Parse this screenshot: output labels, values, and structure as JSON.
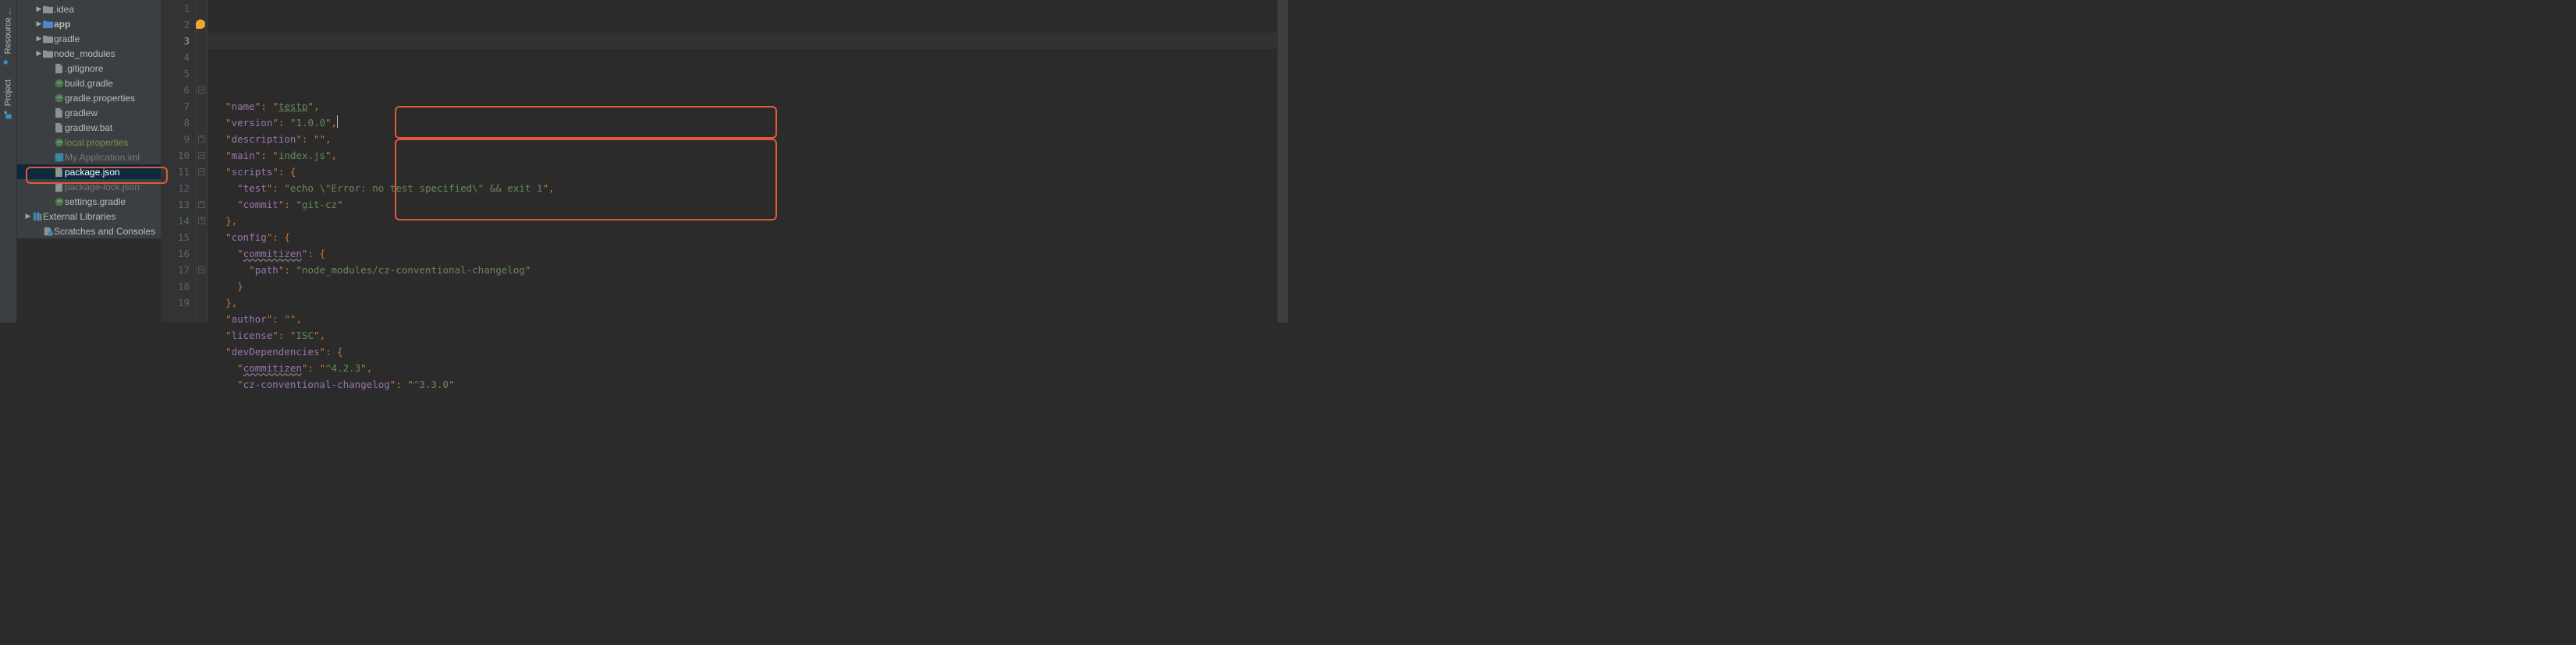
{
  "toolwindows": {
    "resource": {
      "label": "Resource ..."
    },
    "project": {
      "label": "Project"
    }
  },
  "tree": {
    "items": [
      {
        "indent": 24,
        "arrow": "▶",
        "icon": "folder",
        "label": ".idea",
        "style": ""
      },
      {
        "indent": 24,
        "arrow": "▶",
        "icon": "folder-app",
        "label": "app",
        "style": "bold"
      },
      {
        "indent": 24,
        "arrow": "▶",
        "icon": "folder",
        "label": "gradle",
        "style": ""
      },
      {
        "indent": 24,
        "arrow": "▶",
        "icon": "folder",
        "label": "node_modules",
        "style": ""
      },
      {
        "indent": 38,
        "arrow": "",
        "icon": "file",
        "label": ".gitignore",
        "style": ""
      },
      {
        "indent": 38,
        "arrow": "",
        "icon": "gradle",
        "label": "build.gradle",
        "style": ""
      },
      {
        "indent": 38,
        "arrow": "",
        "icon": "gradle",
        "label": "gradle.properties",
        "style": ""
      },
      {
        "indent": 38,
        "arrow": "",
        "icon": "file",
        "label": "gradlew",
        "style": ""
      },
      {
        "indent": 38,
        "arrow": "",
        "icon": "file",
        "label": "gradlew.bat",
        "style": ""
      },
      {
        "indent": 38,
        "arrow": "",
        "icon": "gradle",
        "label": "local.properties",
        "style": "olive"
      },
      {
        "indent": 38,
        "arrow": "",
        "icon": "iml",
        "label": "My Application.iml",
        "style": "grey"
      },
      {
        "indent": 38,
        "arrow": "",
        "icon": "json",
        "label": "package.json",
        "style": "",
        "selected": true
      },
      {
        "indent": 38,
        "arrow": "",
        "icon": "json",
        "label": "package-lock.json",
        "style": "grey"
      },
      {
        "indent": 38,
        "arrow": "",
        "icon": "gradle",
        "label": "settings.gradle",
        "style": ""
      },
      {
        "indent": 10,
        "arrow": "▶",
        "icon": "lib",
        "label": "External Libraries",
        "style": ""
      },
      {
        "indent": 24,
        "arrow": "",
        "icon": "scratch",
        "label": "Scratches and Consoles",
        "style": ""
      }
    ]
  },
  "editor": {
    "start_line": 1,
    "current_line": 3,
    "lines": [
      {
        "n": 1,
        "txt": ""
      },
      {
        "n": 2,
        "key": "name",
        "val": "testp",
        "open": true,
        "us": true
      },
      {
        "n": 3,
        "key": "version",
        "val": "1.0.0",
        "caret": true
      },
      {
        "n": 4,
        "key": "description",
        "val": ""
      },
      {
        "n": 5,
        "key": "main",
        "val": "index.js"
      },
      {
        "n": 6,
        "key": "scripts",
        "obj_open": true
      },
      {
        "n": 7,
        "key": "test",
        "val": "echo \\\"Error: no test specified\\\" && exit 1",
        "indent": 1
      },
      {
        "n": 8,
        "key": "commit",
        "val": "git-cz",
        "indent": 1,
        "last": true
      },
      {
        "n": 9,
        "obj_close": true
      },
      {
        "n": 10,
        "key": "config",
        "obj_open": true
      },
      {
        "n": 11,
        "key": "commitizen",
        "obj_open": true,
        "indent": 1,
        "uk": true
      },
      {
        "n": 12,
        "key": "path",
        "val": "node_modules/cz-conventional-changelog",
        "indent": 2,
        "last": true
      },
      {
        "n": 13,
        "obj_close": true,
        "indent": 1,
        "last": true
      },
      {
        "n": 14,
        "obj_close": true
      },
      {
        "n": 15,
        "key": "author",
        "val": ""
      },
      {
        "n": 16,
        "key": "license",
        "val": "ISC"
      },
      {
        "n": 17,
        "key": "devDependencies",
        "obj_open": true
      },
      {
        "n": 18,
        "key": "commitizen",
        "val": "^4.2.3",
        "indent": 1,
        "uk": true
      },
      {
        "n": 19,
        "key": "cz-conventional-changelog",
        "val": "^3.3.0",
        "indent": 1,
        "last": true
      }
    ]
  }
}
